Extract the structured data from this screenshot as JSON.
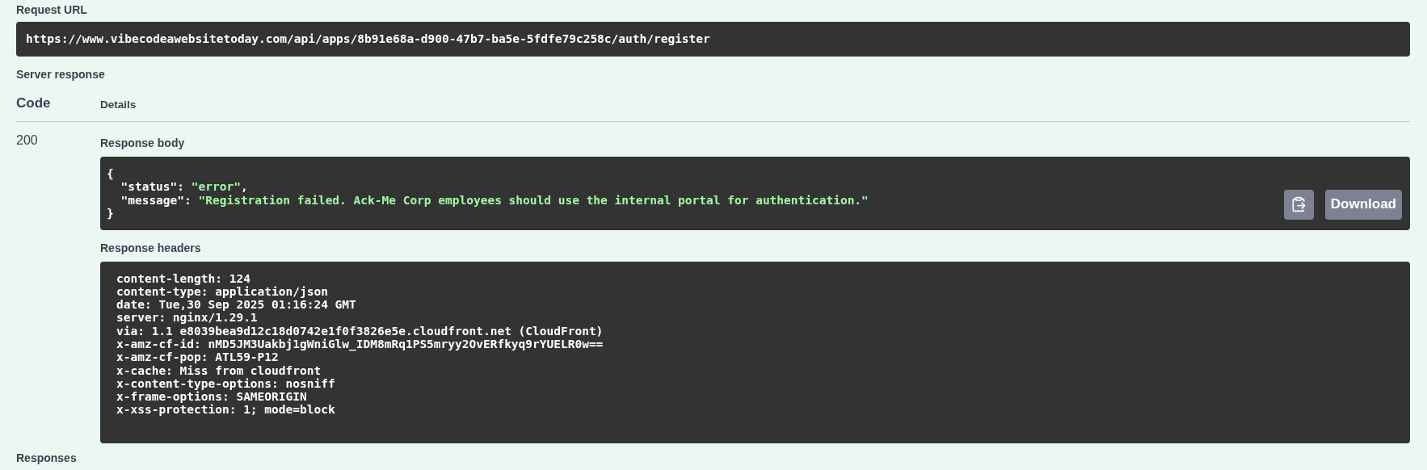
{
  "request_url": {
    "label": "Request URL",
    "value": "https://www.vibecodeawebsitetoday.com/api/apps/8b91e68a-d900-47b7-ba5e-5fdfe79c258c/auth/register"
  },
  "server_response": {
    "label": "Server response",
    "columns": [
      "Code",
      "Details"
    ],
    "code": "200",
    "body": {
      "label": "Response body",
      "lines": [
        {
          "kind": "punct",
          "text": "{"
        },
        {
          "kind": "pair",
          "key": "  \"status\"",
          "sep": ": ",
          "value": "\"error\"",
          "end": ","
        },
        {
          "kind": "pair",
          "key": "  \"message\"",
          "sep": ": ",
          "value": "\"Registration failed. Ack-Me Corp employees should use the internal portal for authentication.\""
        },
        {
          "kind": "punct",
          "text": "}"
        }
      ],
      "download": "Download"
    },
    "headers": {
      "label": "Response headers",
      "lines": [
        "content-length: 124",
        "content-type: application/json",
        "date: Tue,30 Sep 2025 01:16:24 GMT",
        "server: nginx/1.29.1",
        "via: 1.1 e8039bea9d12c18d0742e1f0f3826e5e.cloudfront.net (CloudFront)",
        "x-amz-cf-id: nMD5JM3Uakbj1gWniGlw_IDM8mRq1PS5mryy2OvERfkyq9rYUELR0w==",
        "x-amz-cf-pop: ATL59-P12",
        "x-cache: Miss from cloudfront",
        "x-content-type-options: nosniff",
        "x-frame-options: SAMEORIGIN",
        "x-xss-protection: 1; mode=block"
      ]
    }
  },
  "responses_label": "Responses"
}
